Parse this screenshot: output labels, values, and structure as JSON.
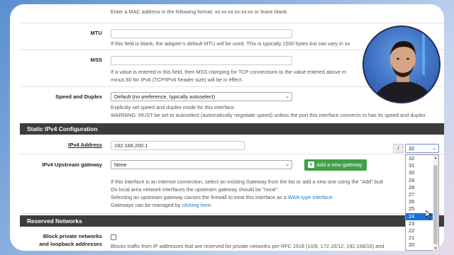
{
  "mac": {
    "help": "Enter a MAC address in the following format: xx:xx:xx:xx:xx:xx or leave blank."
  },
  "mtu": {
    "label": "MTU",
    "value": "",
    "help": "If this field is blank, the adapter's default MTU will be used. This is typically 1500 bytes but can vary in so"
  },
  "mss": {
    "label": "MSS",
    "value": "",
    "help_line1": "If a value is entered in this field, then MSS clamping for TCP connections to the value entered above m",
    "help_line1_tail": "der",
    "help_line2": "minus 60 for IPv6 (TCP/IPv6 header size) will be in effect."
  },
  "speed_duplex": {
    "label": "Speed and Duplex",
    "selected": "Default (no preference, typically autoselect)",
    "help_line1": "Explicitly set speed and duplex mode for this interface.",
    "help_line2": "WARNING: MUST be set to autoselect (automatically negotiate speed) unless the port this interface connects to has its speed and duplex"
  },
  "static_ipv4": {
    "title": "Static IPv4 Configuration",
    "address_label": "IPv4 Address",
    "address_value": "192.168.200.1",
    "slash": "/",
    "cidr_selected": "32",
    "cidr_options": [
      "32",
      "31",
      "30",
      "29",
      "28",
      "27",
      "26",
      "25",
      "24",
      "23",
      "22",
      "21",
      "20",
      "19"
    ],
    "cidr_highlighted": "24",
    "gateway_label": "IPv4 Upstream gateway",
    "gateway_selected": "None",
    "add_gateway_label": "Add a new gateway",
    "help_line1": "If this interface is an Internet connection, select an existing Gateway from the list or add a new one using the \"Add\" butt",
    "help_line2": "On local area network interfaces the upstream gateway should be \"none\".",
    "help_line3_pre": "Selecting an upstream gateway causes the firewall to treat this interface as a ",
    "help_line3_link": "WAN type interface",
    "help_line3_post": ".",
    "help_line4_pre": "Gateways can be managed by ",
    "help_line4_link": "clicking here",
    "help_line4_post": "."
  },
  "reserved": {
    "title": "Reserved Networks",
    "block_private_label_line1": "Block private networks",
    "block_private_label_line2": "and loopback addresses",
    "block_private_checked": false,
    "block_private_help": "Blocks traffic from IP addresses that are reserved for private networks per RFC 1918 (10/8, 172.16/12, 192.168/16) and"
  },
  "colors": {
    "section_bg": "#3c3c3c",
    "button_green": "#43a047",
    "link": "#1e73be",
    "highlight": "#1e6fdc"
  }
}
